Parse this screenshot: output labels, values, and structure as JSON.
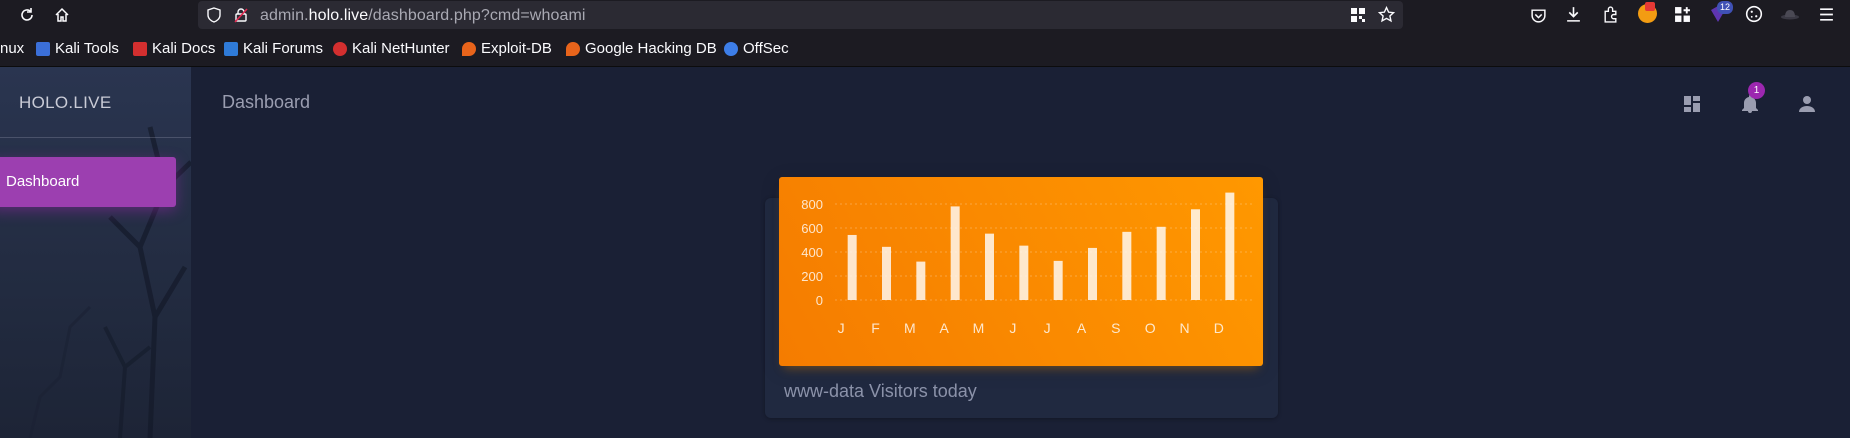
{
  "browser": {
    "url_prefix": "admin.",
    "url_host": "holo.live",
    "url_path": "/dashboard.php?cmd=whoami",
    "extension_badge": "12"
  },
  "bookmarks": [
    {
      "label": "nux",
      "color": "#1c1b22"
    },
    {
      "label": "Kali Tools",
      "color": "#3b6fd8"
    },
    {
      "label": "Kali Docs",
      "color": "#d32f2f"
    },
    {
      "label": "Kali Forums",
      "color": "#2f7bd8"
    },
    {
      "label": "Kali NetHunter",
      "color": "#d32f2f"
    },
    {
      "label": "Exploit-DB",
      "color": "#e8641b"
    },
    {
      "label": "Google Hacking DB",
      "color": "#e8641b"
    },
    {
      "label": "OffSec",
      "color": "#3d7ee8"
    }
  ],
  "sidebar": {
    "brand": "HOLO.LIVE",
    "items": [
      {
        "label": "Dashboard",
        "active": true
      }
    ]
  },
  "topnav": {
    "title": "Dashboard",
    "notification_count": "1"
  },
  "card": {
    "footer_text": "www-data Visitors today"
  },
  "colors": {
    "accent_purple": "#9c27b0",
    "card_orange": "#ff9800",
    "page_bg": "#1a2035"
  },
  "chart_data": {
    "type": "bar",
    "categories": [
      "J",
      "F",
      "M",
      "A",
      "M",
      "J",
      "J",
      "A",
      "S",
      "O",
      "N",
      "D"
    ],
    "values": [
      542,
      443,
      320,
      780,
      553,
      453,
      326,
      434,
      568,
      610,
      756,
      895
    ],
    "yticks": [
      "800",
      "600",
      "400",
      "200",
      "0"
    ],
    "ylim": [
      0,
      900
    ],
    "grid": true
  }
}
